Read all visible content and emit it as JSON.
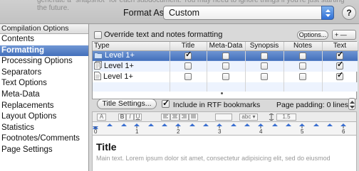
{
  "header": {
    "faded_text": "generate a \"snapshot\" for each subdocument. You may need to ignore things if you're just starting\nthe future.",
    "format_label": "Format As:",
    "format_value": "Custom",
    "help_label": "?"
  },
  "sidebar": {
    "header": "Compilation Options",
    "items": [
      {
        "label": "Contents",
        "selected": false
      },
      {
        "label": "Formatting",
        "selected": true
      },
      {
        "label": "Processing Options",
        "selected": false
      },
      {
        "label": "Separators",
        "selected": false
      },
      {
        "label": "Text Options",
        "selected": false
      },
      {
        "label": "Meta-Data",
        "selected": false
      },
      {
        "label": "Replacements",
        "selected": false
      },
      {
        "label": "Layout Options",
        "selected": false
      },
      {
        "label": "Statistics",
        "selected": false
      },
      {
        "label": "Footnotes/Comments",
        "selected": false
      },
      {
        "label": "Page Settings",
        "selected": false
      }
    ]
  },
  "formatting": {
    "override_label": "Override text and notes formatting",
    "override_checked": false,
    "options_label": "Options...",
    "plus_minus_label": "+ —",
    "columns": [
      "Type",
      "Title",
      "Meta-Data",
      "Synopsis",
      "Notes",
      "Text"
    ],
    "rows": [
      {
        "icon": "folder-icon",
        "label": "Level  1+",
        "title": true,
        "meta": false,
        "synopsis": false,
        "notes": false,
        "text": true
      },
      {
        "icon": "document-stack-icon",
        "label": "Level  1+",
        "title": false,
        "meta": false,
        "synopsis": false,
        "notes": false,
        "text": true
      },
      {
        "icon": "document-icon",
        "label": "Level  1+",
        "title": false,
        "meta": false,
        "synopsis": false,
        "notes": false,
        "text": true
      }
    ],
    "title_settings_label": "Title Settings...",
    "rtf_label": "Include in RTF bookmarks",
    "rtf_checked": true,
    "page_padding_label": "Page padding: 0 lines"
  },
  "editor": {
    "toolbar": {
      "font_btn": "A",
      "bold_btn": "B",
      "italic_btn": "I",
      "underline_btn": "U",
      "list_btn": "abc ▾",
      "spacing_btn": "1.5"
    },
    "ruler_numbers": [
      "0",
      "1",
      "2",
      "3",
      "4",
      "5",
      "6"
    ],
    "preview_title": "Title",
    "preview_body": "Main text. Lorem ipsum dolor sit amet, consectetur adipisicing elit, sed do eiusmod"
  }
}
